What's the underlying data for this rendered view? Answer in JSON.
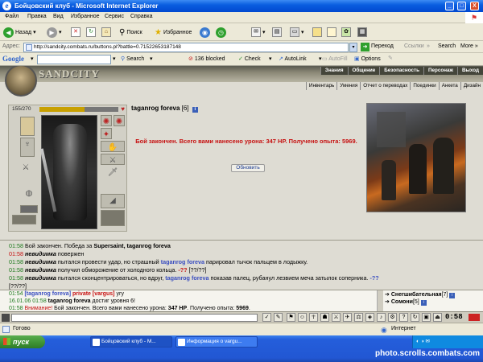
{
  "window": {
    "title": "Бойцовский клуб - Microsoft Internet Explorer",
    "minimize": "_",
    "maximize": "□",
    "close": "X",
    "logo": "e"
  },
  "menu": [
    "Файл",
    "Правка",
    "Вид",
    "Избранное",
    "Сервис",
    "Справка"
  ],
  "toolbar": {
    "back": "Назад",
    "search": "Поиск",
    "favorites": "Избранное"
  },
  "address": {
    "label": "Адрес:",
    "url": "http://sandcity.combats.ru/buttons.pl?battle=0.71522653187148",
    "go": "Переход",
    "links": "Ссылки",
    "search": "Search",
    "more": "More »"
  },
  "google": {
    "logo": "Google",
    "search": "Search",
    "blocked": "136 blocked",
    "check": "Check",
    "autolink": "AutoLink",
    "autofill": "AutoFill",
    "options": "Options"
  },
  "site": {
    "logo": "SANDCITY",
    "nav_top": [
      "Знания",
      "Общение",
      "Безопасность",
      "Персонаж",
      "Выход"
    ],
    "nav_sub": [
      "Инвентарь",
      "Умения",
      "Отчет о переводах",
      "Поединки",
      "Анкета",
      "Дизайн"
    ]
  },
  "character": {
    "hp_text": "155/270",
    "hp_fraction": 0.574,
    "name": "taganrog foreva",
    "level": "[6]",
    "info_badge": "i"
  },
  "battle_result": {
    "message": "Бой закончен. Всего вами нанесено урона: 347 HP. Получено опыта: 5969.",
    "refresh_button": "Обновить"
  },
  "log": [
    {
      "time": "01:58",
      "time_color": "green",
      "parts": [
        {
          "t": "Бой закончен. Победа за ",
          "s": ""
        },
        {
          "t": "Supersaint, taganrog foreva",
          "s": "pn"
        }
      ]
    },
    {
      "time": "01:58",
      "time_color": "red",
      "parts": [
        {
          "t": "невидимка",
          "s": "it"
        },
        {
          "t": " повержен",
          "s": ""
        }
      ]
    },
    {
      "time": "01:58",
      "time_color": "green",
      "parts": [
        {
          "t": "невидимка",
          "s": "it"
        },
        {
          "t": " пытался провести удар, но страшный ",
          "s": ""
        },
        {
          "t": "taganrog foreva",
          "s": "bl"
        },
        {
          "t": " парировал тычок пальцем в лодыжку.",
          "s": ""
        }
      ]
    },
    {
      "time": "01:58",
      "time_color": "green",
      "parts": [
        {
          "t": "невидимка",
          "s": "it"
        },
        {
          "t": " получил обморожение от холодного кольца. ",
          "s": ""
        },
        {
          "t": "-??",
          "s": "rd"
        },
        {
          "t": " [??/??]",
          "s": ""
        }
      ]
    },
    {
      "time": "01:58",
      "time_color": "green",
      "parts": [
        {
          "t": "невидимка",
          "s": "it"
        },
        {
          "t": " пытался сконцентрироваться, но вдруг, ",
          "s": ""
        },
        {
          "t": "taganrog foreva",
          "s": "bl"
        },
        {
          "t": " показав палец, рубанул лезвием меча затылок соперника. ",
          "s": ""
        },
        {
          "t": "-??",
          "s": "bl"
        }
      ]
    },
    {
      "time": "",
      "time_color": "green",
      "parts": [
        {
          "t": "[??/??]",
          "s": ""
        }
      ]
    }
  ],
  "chat": {
    "lines": [
      {
        "time": "01:54",
        "parts": [
          {
            "t": "[taganrog foreva] ",
            "s": "bl"
          },
          {
            "t": "private [vargus]",
            "s": "rd"
          },
          {
            "t": " угу",
            "s": ""
          }
        ]
      },
      {
        "time": "16.01.06 01:58",
        "parts": [
          {
            "t": "taganrog foreva",
            "s": "pn"
          },
          {
            "t": " достиг уровня 6!",
            "s": ""
          }
        ]
      },
      {
        "time": "01:58",
        "parts": [
          {
            "t": "Внимание!",
            "s": "dr"
          },
          {
            "t": " Бой закончен. Всего вами нанесено урона: ",
            "s": ""
          },
          {
            "t": "347 HP",
            "s": "pn"
          },
          {
            "t": ". Получено опыта: ",
            "s": ""
          },
          {
            "t": "5969",
            "s": "pn"
          },
          {
            "t": ".",
            "s": ""
          }
        ]
      }
    ],
    "online": [
      {
        "name": "Снегшибательная",
        "level": "[7]"
      },
      {
        "name": "Сомони",
        "level": "[5]"
      }
    ]
  },
  "gamebar": {
    "clock": "0:58"
  },
  "status": {
    "left": "Готово",
    "zone": "Интернет"
  },
  "taskbar": {
    "start": "пуск",
    "tasks": [
      "Бойцовский клуб - M...",
      "Информация о vargu..."
    ],
    "watermark": "photo.scrolls.combats.com"
  },
  "colors": {
    "titlebar": "#0a5ee0",
    "result_red": "#c61010",
    "log_time_green": "#1e7a1e",
    "player_blue": "#3a4ec0",
    "taskbar": "#245edb",
    "start_green": "#3d9233"
  }
}
